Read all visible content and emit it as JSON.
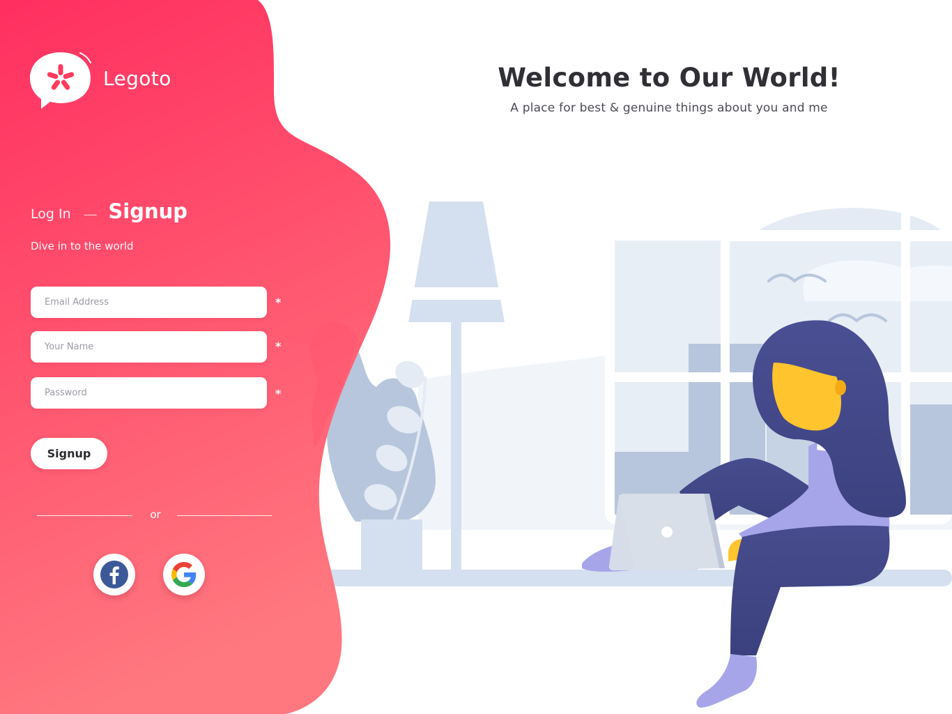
{
  "brand": {
    "name": "Legoto",
    "logo_icon": "speech-bubble-asterisk-icon"
  },
  "hero": {
    "title": "Welcome to Our World!",
    "subtitle": "A place for best & genuine things about you and me"
  },
  "auth": {
    "tab_login": "Log In",
    "tab_separator": "—-",
    "tab_signup": "Signup",
    "active_tab": "Signup",
    "tagline": "Dive in to the world",
    "fields": [
      {
        "placeholder": "Email Address",
        "value": "",
        "required_mark": "*"
      },
      {
        "placeholder": "Your Name",
        "value": "",
        "required_mark": "*"
      },
      {
        "placeholder": "Password",
        "value": "",
        "required_mark": "*"
      }
    ],
    "submit_label": "Signup",
    "divider_text": "or",
    "social": [
      {
        "provider": "facebook",
        "icon": "facebook-icon"
      },
      {
        "provider": "google",
        "icon": "google-icon"
      }
    ]
  },
  "colors": {
    "gradient_top": "#ff2f5f",
    "gradient_bottom": "#ff787f",
    "illustration_light": "#d4e0ef",
    "illustration_mid": "#b7c6dc",
    "character_navy": "#454b8c",
    "character_lilac": "#a7a5ea",
    "skin": "#ffc42e"
  }
}
